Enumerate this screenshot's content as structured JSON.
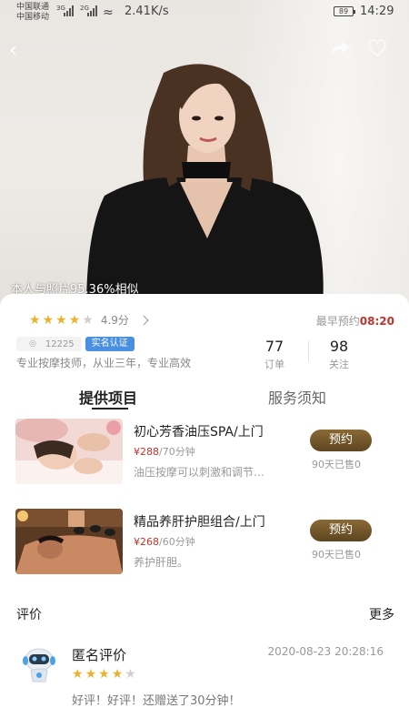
{
  "status_bar": {
    "carrier_1": "中国联通",
    "carrier_2": "中国移动",
    "net_1": "3G",
    "net_2": "2G",
    "speed": "2.41K/s",
    "battery": "89",
    "time": "14:29"
  },
  "hero": {
    "similarity_text": "本人与照片95.36%相似"
  },
  "profile": {
    "rating": 4,
    "rating_max": 5,
    "score_text": "4.9分",
    "earliest_label": "最早预约",
    "earliest_time": "08:20",
    "location_id": "12225",
    "verified_label": "实名认证",
    "bio": "专业按摩技师，从业三年，专业高效",
    "stats": [
      {
        "value": "77",
        "label": "订单"
      },
      {
        "value": "98",
        "label": "关注"
      }
    ]
  },
  "tabs": [
    {
      "label": "提供项目",
      "active": true
    },
    {
      "label": "服务须知",
      "active": false
    }
  ],
  "services": [
    {
      "title": "初心芳香油压SPA/上门",
      "price": "¥288",
      "duration": "/70分钟",
      "desc": "油压按摩可以刺激和调节…",
      "button": "预约",
      "sold": "90天已售0"
    },
    {
      "title": "精品养肝护胆组合/上门",
      "price": "¥268",
      "duration": "/60分钟",
      "desc": "养护肝胆。",
      "button": "预约",
      "sold": "90天已售0"
    }
  ],
  "reviews": {
    "title": "评价",
    "more": "更多",
    "items": [
      {
        "name": "匿名评价",
        "time": "2020-08-23 20:28:16",
        "rating": 4,
        "text": "好评！好评！还赠送了30分钟！"
      }
    ]
  },
  "colors": {
    "accent_red": "#c2322b",
    "star_gold": "#e9b22f",
    "button_brown": "#6e5228",
    "verified_blue": "#4a90e2"
  }
}
